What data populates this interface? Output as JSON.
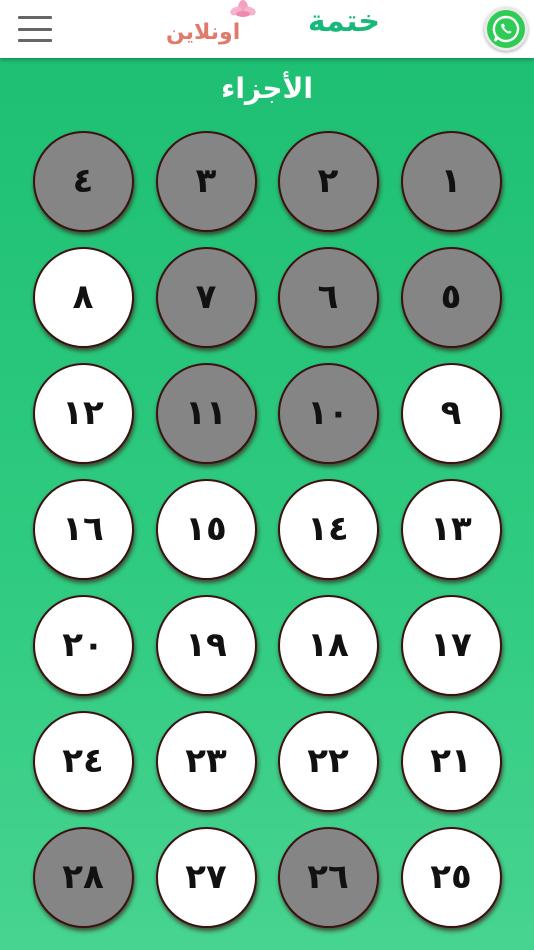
{
  "header": {
    "logo_main": "ختمة",
    "logo_sub": "اونلاين"
  },
  "title": "الأجزاء",
  "colors": {
    "read": "#858585",
    "unread": "#ffffff",
    "background": "#1cbe72"
  },
  "parts": [
    {
      "label": "١",
      "state": "read"
    },
    {
      "label": "٢",
      "state": "read"
    },
    {
      "label": "٣",
      "state": "read"
    },
    {
      "label": "٤",
      "state": "read"
    },
    {
      "label": "٥",
      "state": "read"
    },
    {
      "label": "٦",
      "state": "read"
    },
    {
      "label": "٧",
      "state": "read"
    },
    {
      "label": "٨",
      "state": "unread"
    },
    {
      "label": "٩",
      "state": "unread"
    },
    {
      "label": "١٠",
      "state": "read"
    },
    {
      "label": "١١",
      "state": "read"
    },
    {
      "label": "١٢",
      "state": "unread"
    },
    {
      "label": "١٣",
      "state": "unread"
    },
    {
      "label": "١٤",
      "state": "unread"
    },
    {
      "label": "١٥",
      "state": "unread"
    },
    {
      "label": "١٦",
      "state": "unread"
    },
    {
      "label": "١٧",
      "state": "unread"
    },
    {
      "label": "١٨",
      "state": "unread"
    },
    {
      "label": "١٩",
      "state": "unread"
    },
    {
      "label": "٢٠",
      "state": "unread"
    },
    {
      "label": "٢١",
      "state": "unread"
    },
    {
      "label": "٢٢",
      "state": "unread"
    },
    {
      "label": "٢٣",
      "state": "unread"
    },
    {
      "label": "٢٤",
      "state": "unread"
    },
    {
      "label": "٢٥",
      "state": "unread"
    },
    {
      "label": "٢٦",
      "state": "read"
    },
    {
      "label": "٢٧",
      "state": "unread"
    },
    {
      "label": "٢٨",
      "state": "read"
    }
  ]
}
